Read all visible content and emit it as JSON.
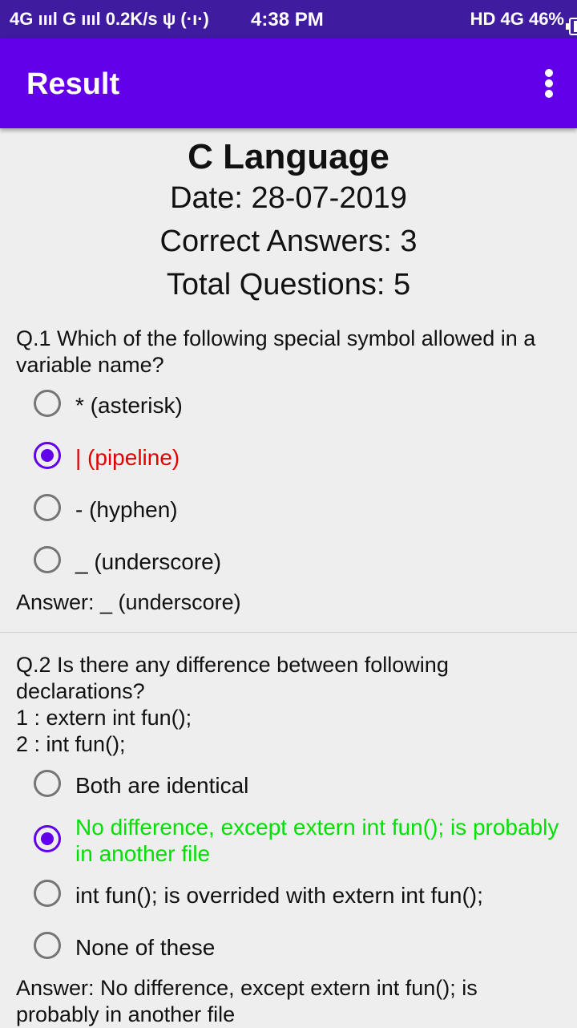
{
  "statusbar": {
    "left": "4G ıııl G ıııl 0.2K/s ψ (·ı·)",
    "time": "4:38 PM",
    "right": "HD 4G 46%"
  },
  "appbar": {
    "title": "Result"
  },
  "header": {
    "subject": "C Language",
    "date": "Date: 28-07-2019",
    "correct": "Correct Answers: 3",
    "total": "Total Questions: 5"
  },
  "questions": [
    {
      "text": "Q.1 Which of the following special symbol allowed in a variable name?",
      "options": [
        "* (asterisk)",
        "| (pipeline)",
        "- (hyphen)",
        "_ (underscore)"
      ],
      "answer": "Answer:  _ (underscore)"
    },
    {
      "text_lines": [
        "Q.2 Is there any difference between following declarations?",
        "1 : extern int fun();",
        "2 : int fun();"
      ],
      "options": [
        "Both are identical",
        "No difference, except extern int fun(); is probably in another file",
        "int fun(); is overrided with extern int fun();",
        "None of these"
      ],
      "answer": "Answer:  No difference, except extern int fun(); is probably in another file"
    }
  ],
  "colors": {
    "appbar": "#6200ea",
    "statusbar": "#3f1ba0",
    "wrong": "#e00000",
    "correct": "#00e000"
  }
}
